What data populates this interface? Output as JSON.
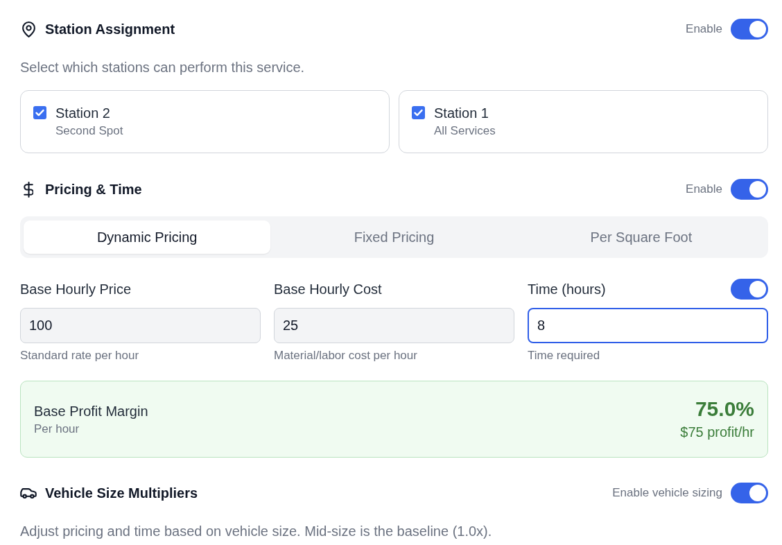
{
  "station_assignment": {
    "title": "Station Assignment",
    "toggle": {
      "label": "Enable",
      "on": true
    },
    "description": "Select which stations can perform this service.",
    "stations": [
      {
        "name": "Station 2",
        "subtitle": "Second Spot",
        "checked": true
      },
      {
        "name": "Station 1",
        "subtitle": "All Services",
        "checked": true
      }
    ]
  },
  "pricing_time": {
    "title": "Pricing & Time",
    "toggle": {
      "label": "Enable",
      "on": true
    },
    "tabs": [
      {
        "label": "Dynamic Pricing",
        "selected": true
      },
      {
        "label": "Fixed Pricing",
        "selected": false
      },
      {
        "label": "Per Square Foot",
        "selected": false
      }
    ],
    "fields": [
      {
        "label": "Base Hourly Price",
        "value": "100",
        "hint": "Standard rate per hour",
        "focused": false
      },
      {
        "label": "Base Hourly Cost",
        "value": "25",
        "hint": "Material/labor cost per hour",
        "focused": false
      },
      {
        "label": "Time (hours)",
        "value": "8",
        "hint": "Time required",
        "focused": true,
        "toggle": {
          "on": true
        }
      }
    ],
    "profit_margin": {
      "title": "Base Profit Margin",
      "subtitle": "Per hour",
      "percent": "75.0%",
      "amount": "$75 profit/hr"
    }
  },
  "vehicle_size_multipliers": {
    "title": "Vehicle Size Multipliers",
    "toggle": {
      "label": "Enable vehicle sizing",
      "on": true
    },
    "description": "Adjust pricing and time based on vehicle size. Mid-size is the baseline (1.0x)."
  }
}
